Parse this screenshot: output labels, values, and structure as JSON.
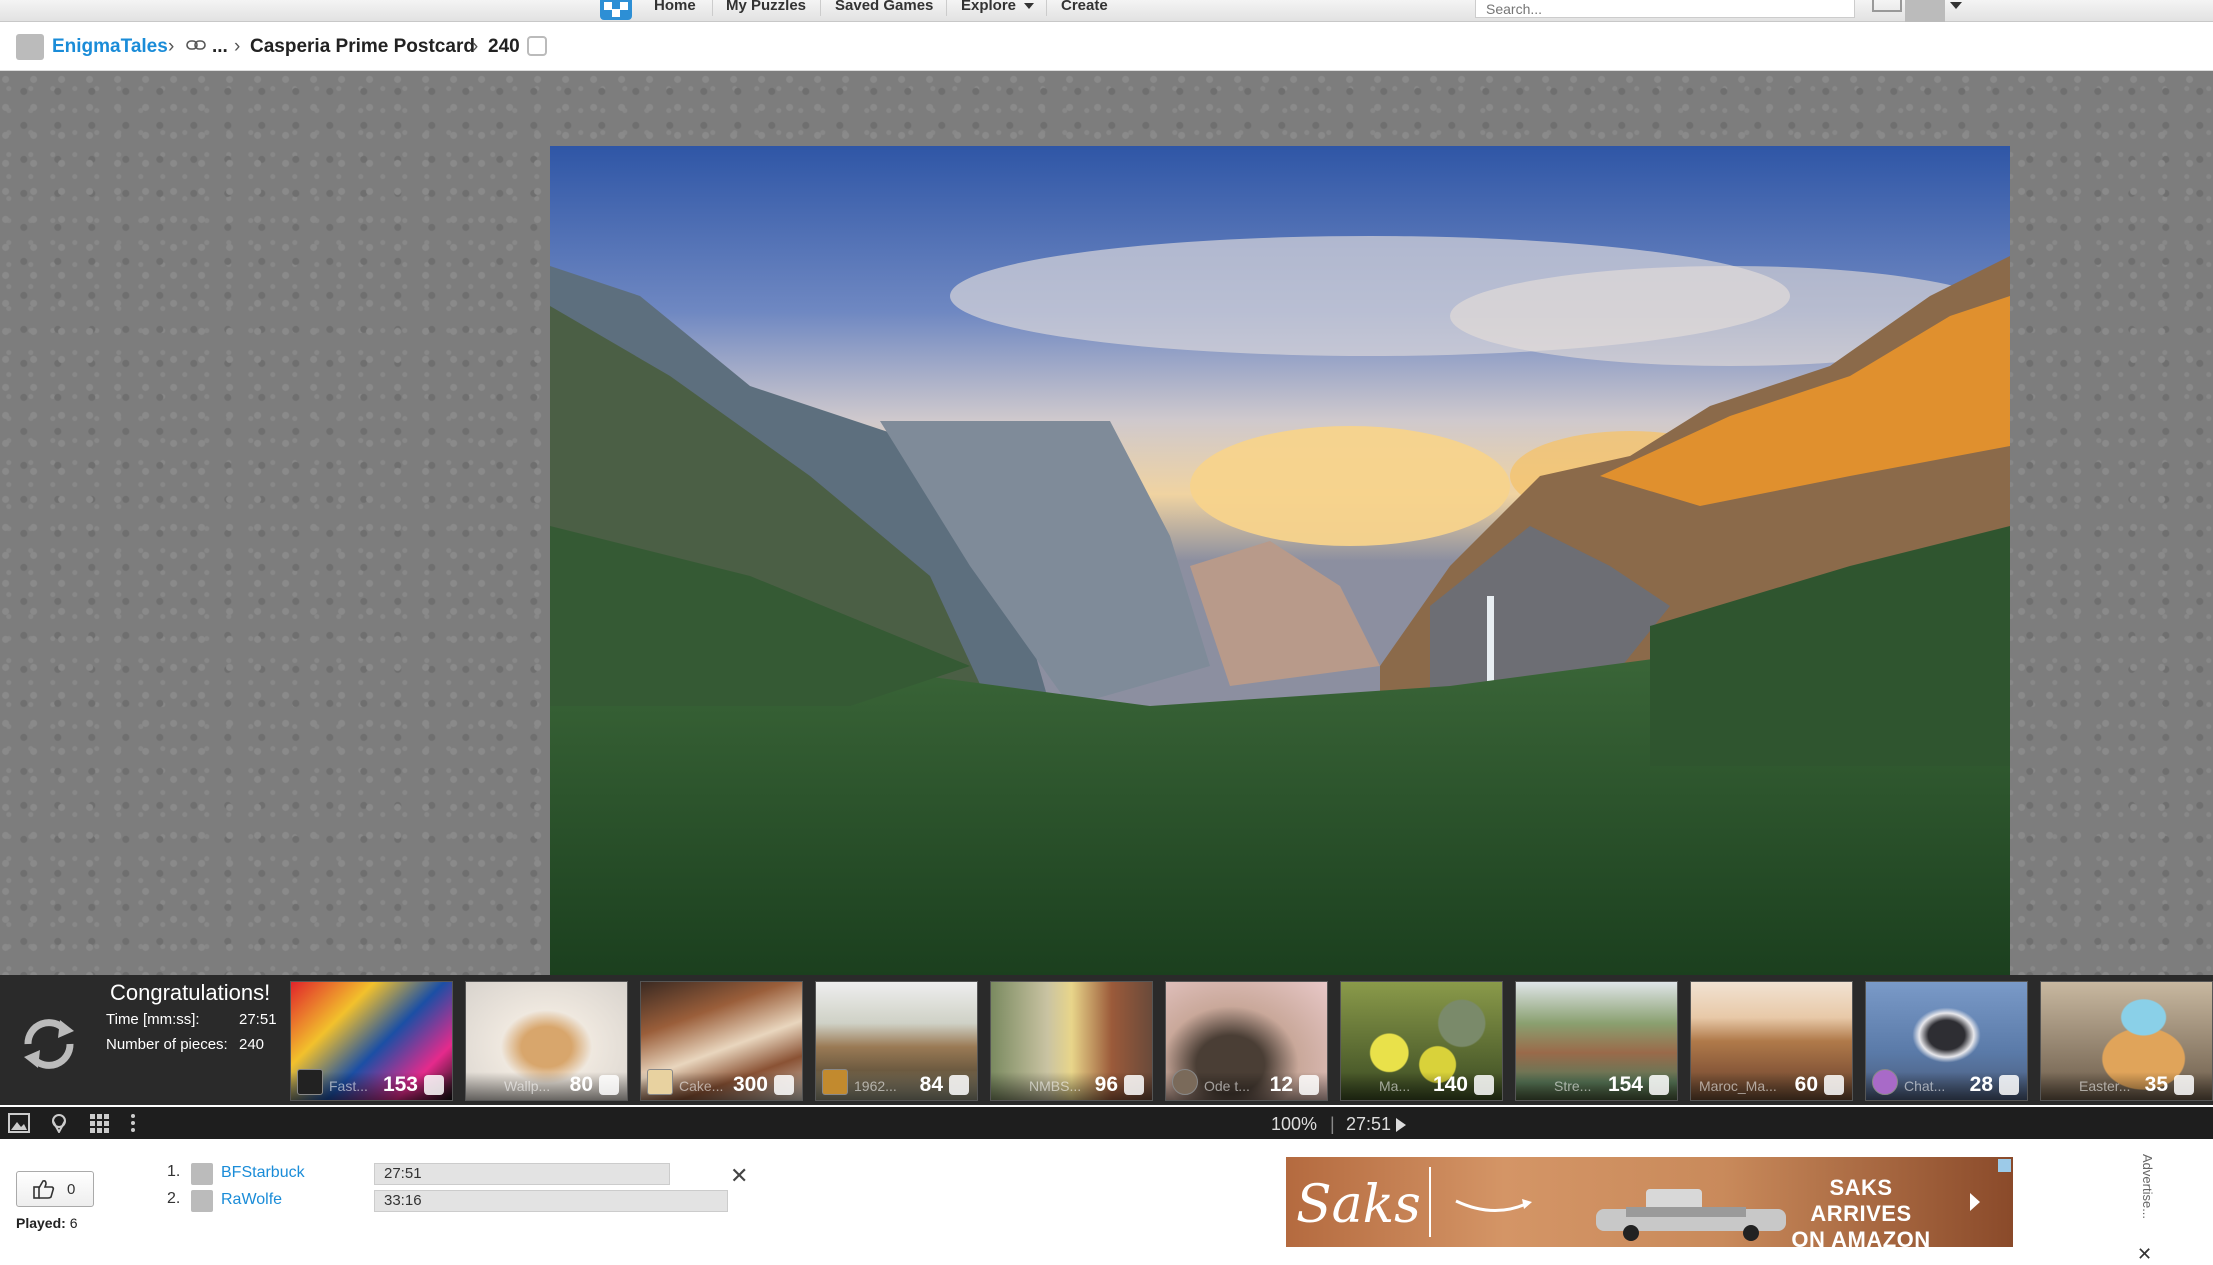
{
  "topnav": {
    "items": [
      "Home",
      "My Puzzles",
      "Saved Games",
      "Explore",
      "Create"
    ],
    "search_placeholder": "Search..."
  },
  "breadcrumb": {
    "user": "EnigmaTales",
    "ellipsis": "...",
    "puzzle": "Casperia Prime Postcard",
    "pieces": "240"
  },
  "result": {
    "title": "Congratulations!",
    "time_label": "Time [mm:ss]:",
    "time_value": "27:51",
    "pieces_label": "Number of pieces:",
    "pieces_value": "240"
  },
  "thumbnails": [
    {
      "name": "Fast...",
      "count": "153",
      "color": "#d8262b"
    },
    {
      "name": "Wallp...",
      "count": "80",
      "color": "#e8e1d7"
    },
    {
      "name": "Cake...",
      "count": "300",
      "color": "#a8724a"
    },
    {
      "name": "1962...",
      "count": "84",
      "color": "#8a7b55"
    },
    {
      "name": "NMBS...",
      "count": "96",
      "color": "#6e7a5c"
    },
    {
      "name": "Ode t...",
      "count": "12",
      "color": "#9a8a7a"
    },
    {
      "name": "Ma...",
      "count": "140",
      "color": "#b5c23a"
    },
    {
      "name": "Stre...",
      "count": "154",
      "color": "#6c8a5a"
    },
    {
      "name": "Maroc_Ma...",
      "count": "60",
      "color": "#c8945e"
    },
    {
      "name": "Chat...",
      "count": "28",
      "color": "#6b8ab0"
    },
    {
      "name": "Easter...",
      "count": "35",
      "color": "#d6a45a"
    }
  ],
  "toolbar": {
    "zoom": "100%",
    "separator": "|",
    "timer": "27:51"
  },
  "footer": {
    "likes": "0",
    "played_label": "Played:",
    "played_value": "6",
    "leaderboard": [
      {
        "rank": "1.",
        "name": "BFStarbuck",
        "time": "27:51"
      },
      {
        "rank": "2.",
        "name": "RaWolfe",
        "time": "33:16"
      }
    ],
    "close": "✕"
  },
  "ad": {
    "brand": "Saks",
    "headline_1": "SAKS ARRIVES",
    "headline_2": "ON AMAZON",
    "advertise_label": "Advertise...",
    "close": "✕"
  }
}
